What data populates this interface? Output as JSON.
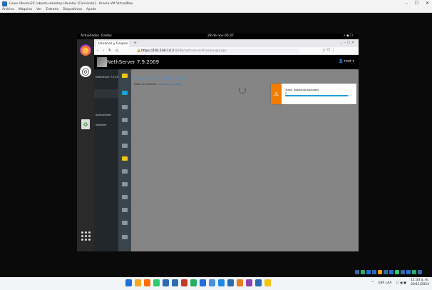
{
  "vbox": {
    "title": "Linux Ubuntu22 (ubuntu-desktop Ubuntu) [Corriendo] - Oracle VM VirtualBox",
    "menu": [
      "Archivo",
      "Máquina",
      "Ver",
      "Entrada",
      "Dispositivos",
      "Ayuda"
    ],
    "controls": [
      "–",
      "☐",
      "✕"
    ]
  },
  "gnome": {
    "activities": "Actividades",
    "app": "Firefox",
    "clock": "29 de nov 00:37",
    "system": "⚡ ◆ ☐"
  },
  "dock": {
    "firefox": "firefox-icon",
    "ubuntu": "ubuntu-software-icon",
    "trash": "♻",
    "apps": "app-grid-icon"
  },
  "browser": {
    "tab_title": "Usuarios y Grupos - NethServer",
    "new_tab": "+",
    "nav_back": "‹",
    "nav_forward": "›",
    "nav_reload": "↻",
    "nav_home": "⌂",
    "url_host": "https://192.168.10.2",
    "url_path": ":9090/nethserver#/users-groups",
    "right_tools": "☆ ⛉ ⋮"
  },
  "cockpit": {
    "title": "NethServer 7.9.2009",
    "user": "👤 root ▾",
    "side_items": [
      "NethServer 7.9.2009",
      "Aplicaciones",
      "Software"
    ],
    "page_title": "Usuarios y Grupos",
    "breadcrumb_prefix": "Estás en: Sistema /",
    "breadcrumb_current": "Usuarios y grupos"
  },
  "notification": {
    "icon": "⚠",
    "message": "Tarea: Instalando paquetes",
    "progress_text": "2",
    "progress": 0.95
  },
  "windows": {
    "tray_lang": "ESP LAA",
    "time": "11:33 a. m.",
    "date": "29/11/2024",
    "taskbar_colors": [
      "#1e6fd9",
      "#f5a623",
      "#ff6f00",
      "#2ecc71",
      "#2b6cb0",
      "#2b6cb0",
      "#c0392b",
      "#27ae60",
      "#1e6fd9",
      "#4a90e2",
      "#1e88e5",
      "#2b6cb0",
      "#e67e22",
      "#8e44ad",
      "#2b6cb0",
      "#f1c40f"
    ]
  }
}
